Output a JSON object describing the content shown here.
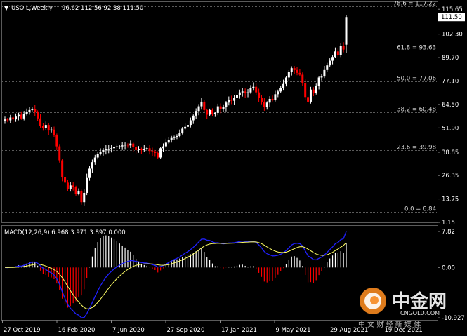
{
  "window": {
    "title": "USOIL,Weekly",
    "ohlc": "96.62 112.56 92.38 111.50"
  },
  "colors": {
    "background": "#000000",
    "bull": "#ffffff",
    "bear": "#ff0000",
    "fib_line": "#5a5a5a",
    "macd_line": "#2020ff",
    "signal_line": "#ffff66",
    "current_price_bg": "#ffffff",
    "watermark_orange": "#f6881f"
  },
  "fib_levels": [
    {
      "label": "78.6 = 117.22",
      "value": 117.22
    },
    {
      "label": "61.8 = 93.63",
      "value": 93.63
    },
    {
      "label": "50.0 = 77.06",
      "value": 77.06
    },
    {
      "label": "38.2 = 60.48",
      "value": 60.48
    },
    {
      "label": "23.6 = 39.98",
      "value": 39.98
    },
    {
      "label": "0.0 = 6.84",
      "value": 6.84
    }
  ],
  "price_axis": {
    "ticks": [
      {
        "label": "115.65",
        "value": 115.65
      },
      {
        "label": "102.30",
        "value": 102.3
      },
      {
        "label": "89.70",
        "value": 89.7
      },
      {
        "label": "77.10",
        "value": 77.1
      },
      {
        "label": "64.50",
        "value": 64.5
      },
      {
        "label": "51.90",
        "value": 51.9
      },
      {
        "label": "38.85",
        "value": 38.85
      },
      {
        "label": "26.35",
        "value": 26.35
      },
      {
        "label": "13.75",
        "value": 13.75
      },
      {
        "label": "1.15",
        "value": 1.15
      }
    ],
    "current_price_label": "111.50",
    "current_price": 111.5
  },
  "macd": {
    "title": "MACD(12,26,9) 6.968 3.971 3.897 0.000",
    "axis_ticks": [
      {
        "label": "7.82",
        "value": 7.82
      },
      {
        "label": "0.00",
        "value": 0.0
      },
      {
        "label": "-10.927",
        "value": -10.927
      }
    ]
  },
  "time_axis": {
    "labels": [
      "27 Oct 2019",
      "16 Feb 2020",
      "7 Jun 2020",
      "27 Sep 2020",
      "17 Jan 2021",
      "9 May 2021",
      "29 Aug 2021",
      "19 Dec 2021"
    ]
  },
  "watermark": {
    "brand": "中金网",
    "site": "CNGOLD.COM",
    "tagline": "中 文 财 经 新 媒 体"
  },
  "chart_data": {
    "type": "candlestick",
    "symbol": "USOIL",
    "timeframe": "Weekly",
    "ylim": [
      1.15,
      119.5
    ],
    "closes": [
      56.5,
      56.0,
      57.5,
      56.5,
      58.0,
      59.0,
      57.0,
      59.5,
      60.5,
      61.5,
      62.0,
      60.5,
      57.0,
      53.0,
      52.0,
      53.5,
      50.5,
      51.0,
      48.0,
      42.0,
      34.5,
      25.5,
      22.5,
      19.0,
      21.0,
      20.0,
      16.5,
      18.0,
      12.0,
      17.0,
      25.0,
      30.0,
      33.5,
      36.0,
      38.0,
      39.0,
      40.0,
      40.5,
      40.5,
      41.0,
      41.5,
      42.0,
      42.0,
      42.5,
      43.0,
      42.5,
      43.5,
      41.5,
      40.0,
      40.5,
      40.0,
      40.5,
      41.0,
      39.5,
      39.0,
      38.5,
      36.0,
      41.0,
      42.0,
      44.0,
      45.5,
      46.5,
      47.0,
      47.5,
      49.0,
      51.5,
      52.5,
      53.5,
      56.0,
      58.5,
      61.0,
      63.5,
      66.0,
      61.5,
      59.0,
      61.5,
      59.5,
      60.0,
      63.5,
      62.0,
      63.0,
      65.5,
      67.0,
      66.5,
      68.0,
      69.5,
      71.0,
      71.5,
      70.5,
      71.0,
      73.5,
      74.0,
      71.0,
      68.0,
      66.0,
      63.0,
      65.5,
      67.5,
      67.0,
      70.0,
      71.5,
      73.5,
      75.5,
      79.0,
      82.0,
      84.0,
      83.0,
      81.5,
      80.5,
      76.0,
      68.5,
      66.0,
      72.5,
      70.5,
      74.5,
      79.0,
      79.5,
      83.0,
      85.5,
      88.0,
      90.0,
      93.0,
      91.0,
      96.0,
      94.0,
      111.5
    ]
  }
}
